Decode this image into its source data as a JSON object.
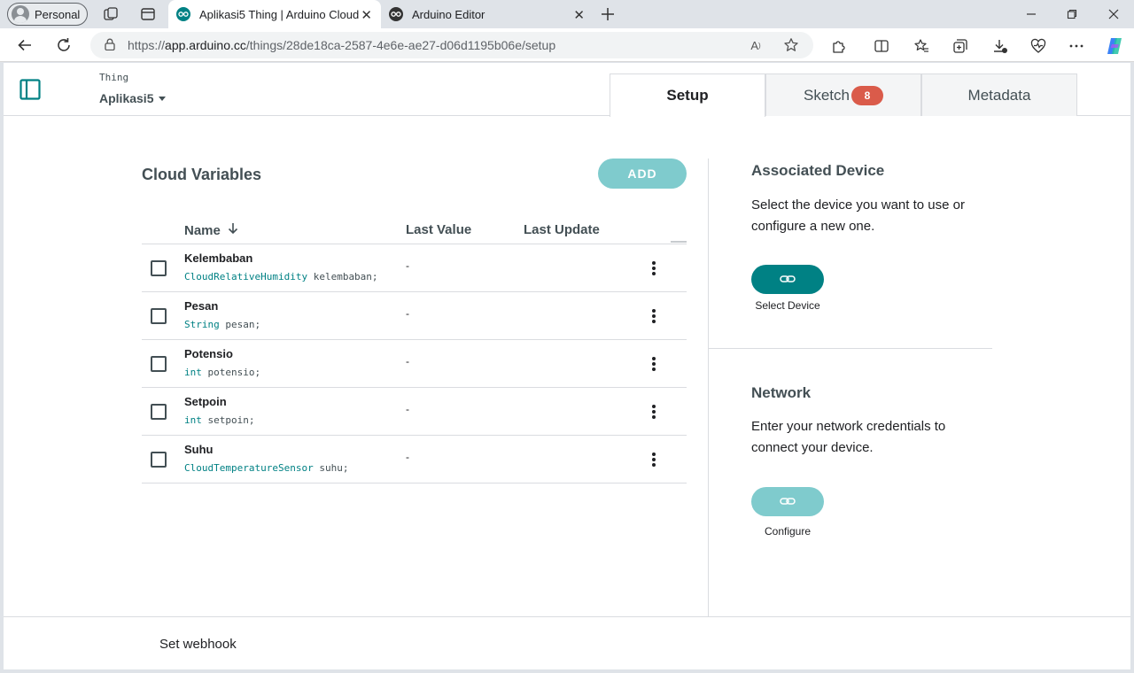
{
  "browser": {
    "profile_label": "Personal",
    "tabs": [
      {
        "label": "Aplikasi5 Thing | Arduino Cloud",
        "active": true
      },
      {
        "label": "Arduino Editor",
        "active": false
      }
    ],
    "url_prefix": "https://",
    "url_host": "app.arduino.cc",
    "url_path": "/things/28de18ca-2587-4e6e-ae27-d06d1195b06e/setup"
  },
  "header": {
    "thing_label": "Thing",
    "thing_name": "Aplikasi5"
  },
  "page_tabs": [
    {
      "label": "Setup",
      "active": true
    },
    {
      "label": "Sketch",
      "badge": "8"
    },
    {
      "label": "Metadata"
    }
  ],
  "variables": {
    "title": "Cloud Variables",
    "add_label": "ADD",
    "columns": {
      "name": "Name",
      "last_value": "Last Value",
      "last_update": "Last Update"
    },
    "rows": [
      {
        "name": "Kelembaban",
        "type": "CloudRelativeHumidity",
        "decl": "kelembaban;",
        "value": "-"
      },
      {
        "name": "Pesan",
        "type": "String",
        "decl": "pesan;",
        "value": "-"
      },
      {
        "name": "Potensio",
        "type": "int",
        "decl": "potensio;",
        "value": "-"
      },
      {
        "name": "Setpoin",
        "type": "int",
        "decl": "setpoin;",
        "value": "-"
      },
      {
        "name": "Suhu",
        "type": "CloudTemperatureSensor",
        "decl": "suhu;",
        "value": "-"
      }
    ]
  },
  "device": {
    "title": "Associated Device",
    "text": "Select the device you want to use or configure a new one.",
    "button_label": "Select Device"
  },
  "network": {
    "title": "Network",
    "text": "Enter your network credentials to connect your device.",
    "button_label": "Configure"
  },
  "footer": {
    "webhook_label": "Set webhook"
  },
  "colors": {
    "teal": "#008184",
    "teal_light": "#7fcbcd",
    "badge": "#da5b4a"
  }
}
